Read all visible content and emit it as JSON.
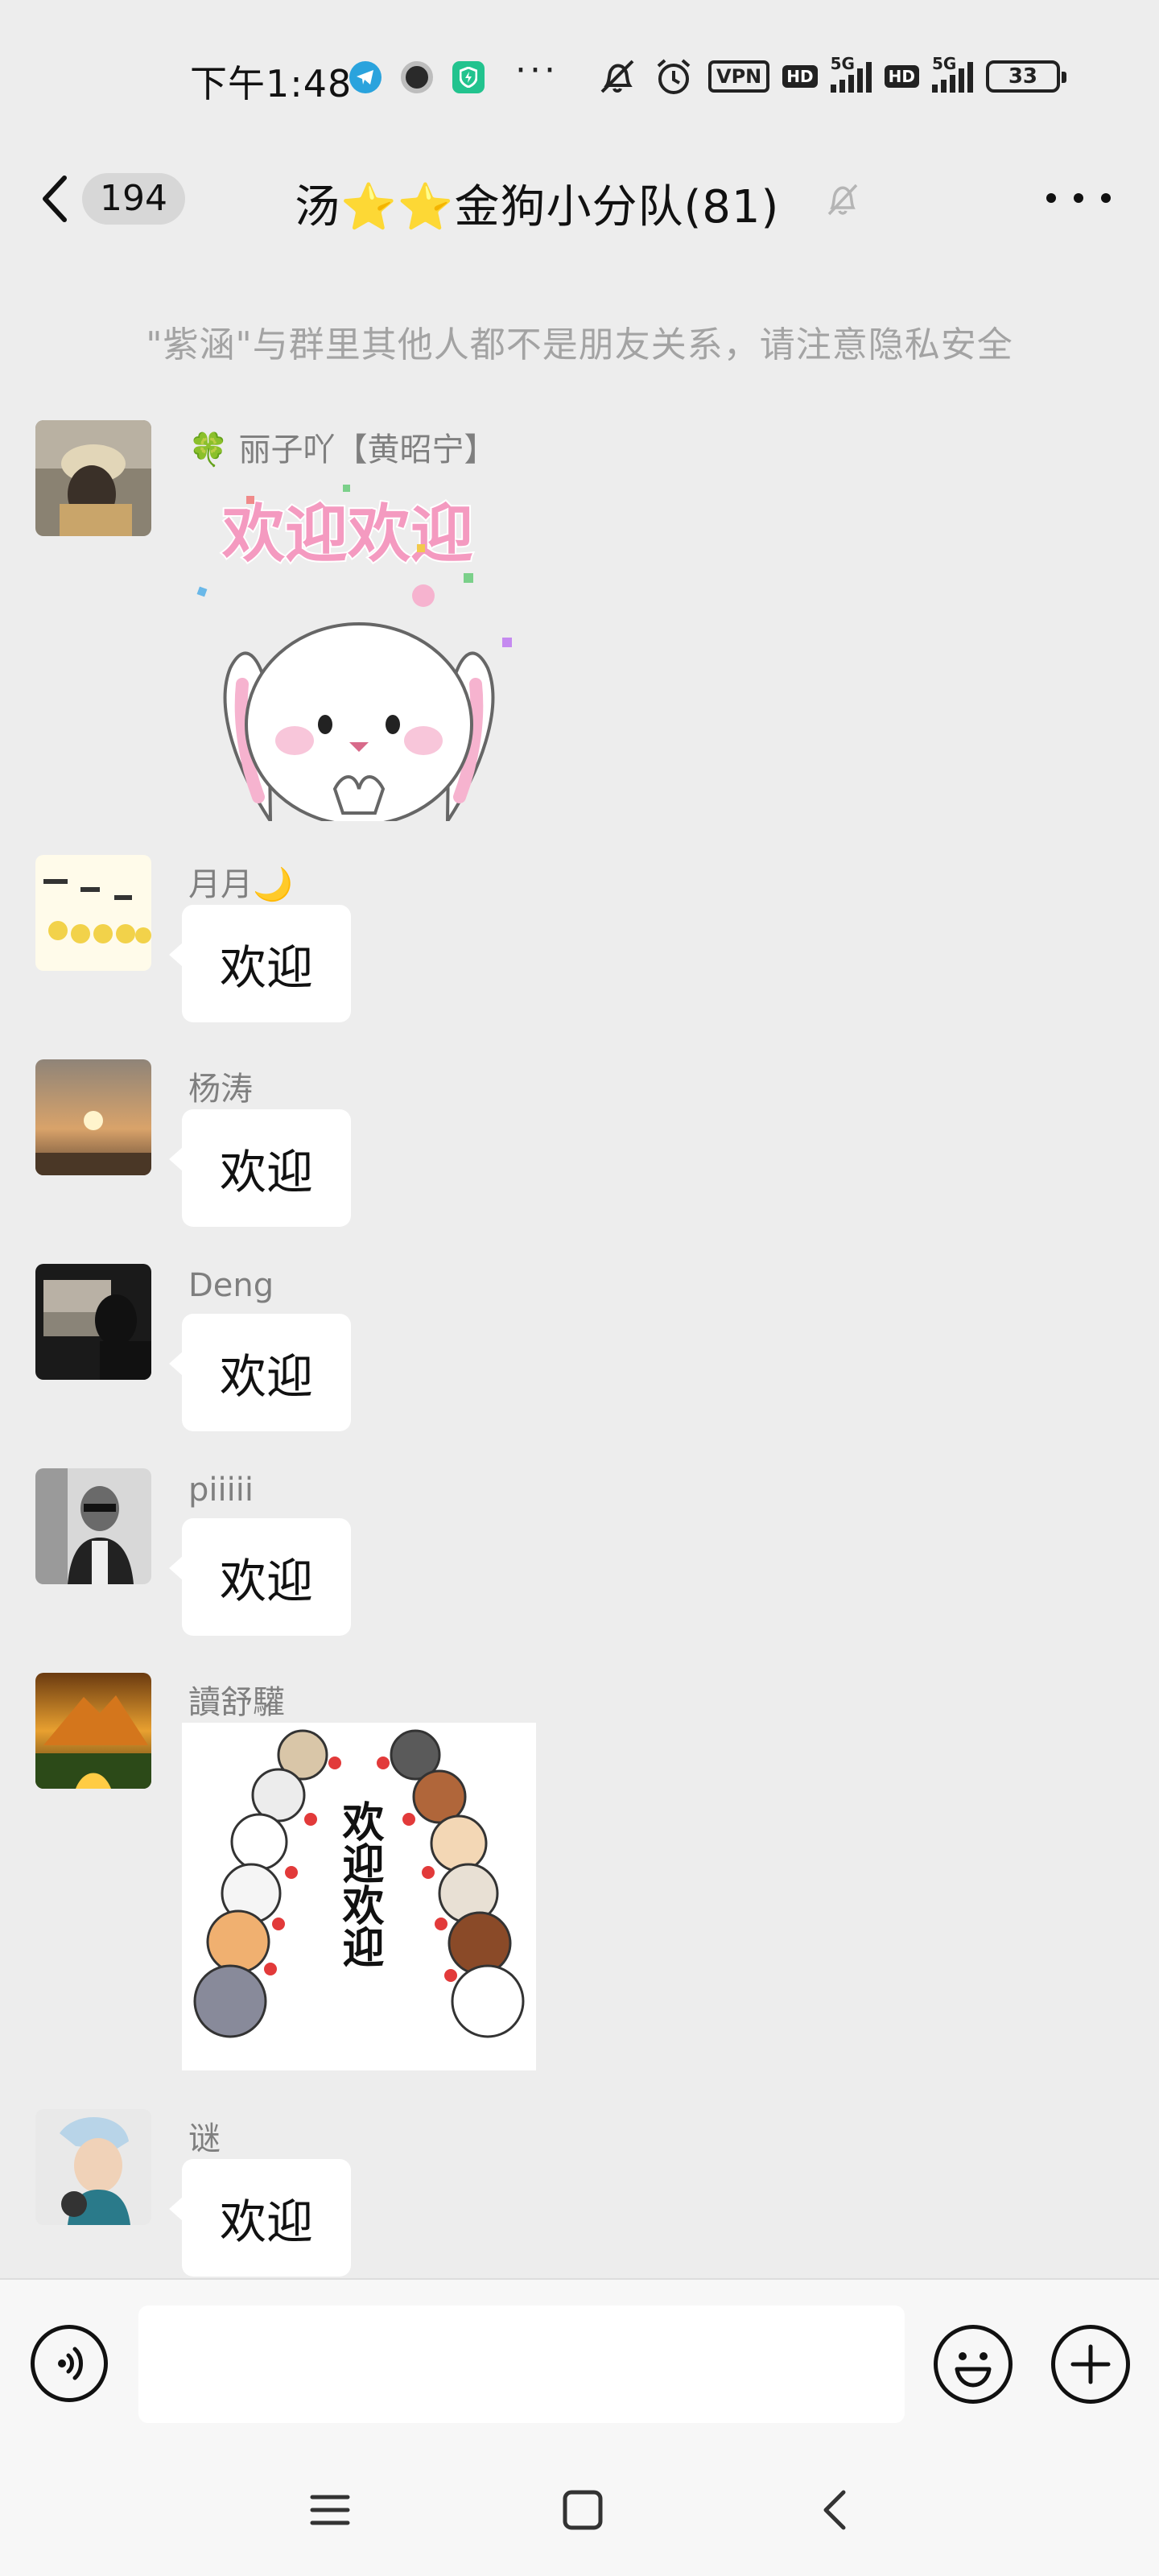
{
  "status_bar": {
    "time": "下午1:48",
    "more": "···",
    "vpn": "VPN",
    "hd1": "HD",
    "net1": "5G",
    "hd2": "HD",
    "net2": "5G",
    "battery": "33",
    "icons": [
      "telegram-icon",
      "circle-app-icon",
      "shield-app-icon",
      "mute-vibrate-icon",
      "alarm-icon",
      "signal-icon",
      "battery-icon"
    ]
  },
  "header": {
    "unread_count": "194",
    "title": "汤⭐️⭐️金狗小分队(81)",
    "icons": [
      "back-arrow-icon",
      "mute-bell-icon",
      "more-icon"
    ]
  },
  "notice": "\"紫涵\"与群里其他人都不是朋友关系，请注意隐私安全",
  "messages": [
    {
      "sender": "🍀 丽子吖【黄昭宁】",
      "type": "sticker",
      "sticker": {
        "caption": "欢迎欢迎",
        "subject": "bunny"
      }
    },
    {
      "sender": "月月🌙",
      "type": "text",
      "text": "欢迎"
    },
    {
      "sender": "杨涛",
      "type": "text",
      "text": "欢迎"
    },
    {
      "sender": "Deng",
      "type": "text",
      "text": "欢迎"
    },
    {
      "sender": "piiiii",
      "type": "text",
      "text": "欢迎"
    },
    {
      "sender": "讀舒驩",
      "type": "sticker",
      "sticker": {
        "caption": "欢迎欢迎",
        "subject": "cats"
      }
    },
    {
      "sender": "谜",
      "type": "text",
      "text": "欢迎"
    }
  ],
  "input": {
    "placeholder": "",
    "value": "",
    "icons": [
      "voice-icon",
      "emoji-icon",
      "plus-icon"
    ]
  },
  "colors": {
    "background": "#ededed",
    "bubble": "#ffffff",
    "sender_name": "#7f7f7f",
    "notice": "#a3a3a3"
  }
}
